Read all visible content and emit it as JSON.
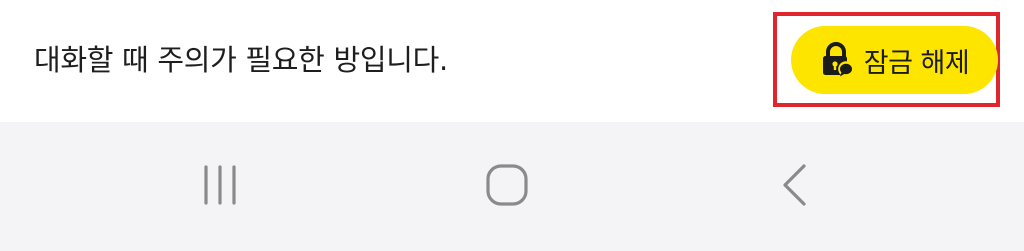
{
  "notice": {
    "text": "대화할 때 주의가 필요한 방입니다."
  },
  "unlock_button": {
    "label": "잠금 해제",
    "icon": "lock-chat-icon",
    "background": "#fde500"
  },
  "highlight": {
    "color": "#e0262c"
  },
  "navigation": {
    "buttons": [
      {
        "icon": "recent-apps-icon"
      },
      {
        "icon": "home-icon"
      },
      {
        "icon": "back-icon"
      }
    ],
    "background": "#f4f4f6"
  }
}
